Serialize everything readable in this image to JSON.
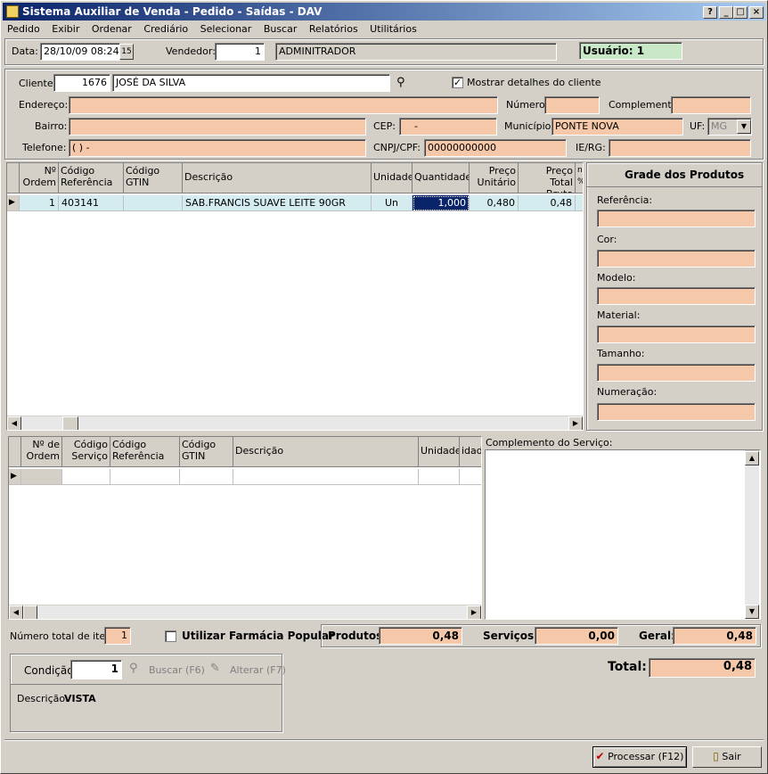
{
  "window": {
    "title": "Sistema Auxiliar de Venda - Pedido - Saídas - DAV",
    "help": "?",
    "min": "_",
    "max": "□",
    "close": "×"
  },
  "menu": [
    "Pedido",
    "Exibir",
    "Ordenar",
    "Crediário",
    "Selecionar",
    "Buscar",
    "Relatórios",
    "Utilitários"
  ],
  "header": {
    "data_label": "Data:",
    "data_value": "28/10/09 08:24",
    "cal": "15",
    "vendedor_label": "Vendedor:",
    "vendedor_code": "1",
    "vendedor_name": "ADMINITRADOR",
    "usuario": "Usuário: 1"
  },
  "cliente": {
    "label": "Cliente:",
    "code": "1676",
    "name": "JOSÉ DA SILVA",
    "mostrar": "Mostrar detalhes do cliente",
    "mostrar_checked": "✓",
    "endereco_label": "Endereço:",
    "numero_label": "Número:",
    "complemento_label": "Complemento:",
    "bairro_label": "Bairro:",
    "cep_label": "CEP:",
    "cep_value": "-",
    "municipio_label": "Município:",
    "municipio_value": "PONTE NOVA",
    "uf_label": "UF:",
    "uf_value": "MG",
    "telefone_label": "Telefone:",
    "telefone_value": "(  )     -",
    "cnpj_label": "CNPJ/CPF:",
    "cnpj_value": "00000000000",
    "ie_label": "IE/RG:"
  },
  "produtos_grid": {
    "headers": [
      "Nº Ordem",
      "Código Referência",
      "Código GTIN",
      "Descrição",
      "Unidade",
      "Quantidade",
      "Preço Unitário",
      "Preço Total Bruto",
      "nto %)"
    ],
    "rows": [
      {
        "ordem": "1",
        "ref": "403141",
        "gtin": "",
        "desc": "SAB.FRANCIS SUAVE LEITE 90GR",
        "un": "Un",
        "qtd": "1,000",
        "preco": "0,480",
        "total": "0,48"
      }
    ]
  },
  "grade": {
    "title": "Grade dos Produtos",
    "labels": [
      "Referência:",
      "Cor:",
      "Modelo:",
      "Material:",
      "Tamanho:",
      "Numeração:"
    ]
  },
  "servicos_grid": {
    "headers": [
      "Nº de Ordem",
      "Código Serviço",
      "Código Referência",
      "Código GTIN",
      "Descrição",
      "Unidade",
      "idade"
    ]
  },
  "complemento_servico": "Complemento do Serviço:",
  "totais": {
    "num_itens_label": "Número total de itens:",
    "num_itens": "1",
    "farmacia": "Utilizar Farmácia Popular",
    "produtos_label": "Produtos:",
    "produtos": "0,48",
    "servicos_label": "Serviços:",
    "servicos": "0,00",
    "geral_label": "Geral:",
    "geral": "0,48"
  },
  "condicao": {
    "label": "Condição:",
    "value": "1",
    "buscar": "Buscar (F6)",
    "alterar": "Alterar (F7)",
    "descricao_label": "Descrição:",
    "descricao": "VISTA"
  },
  "total": {
    "label": "Total:",
    "value": "0,48"
  },
  "buttons": {
    "processar": "Processar (F12)",
    "sair": "Sair"
  }
}
